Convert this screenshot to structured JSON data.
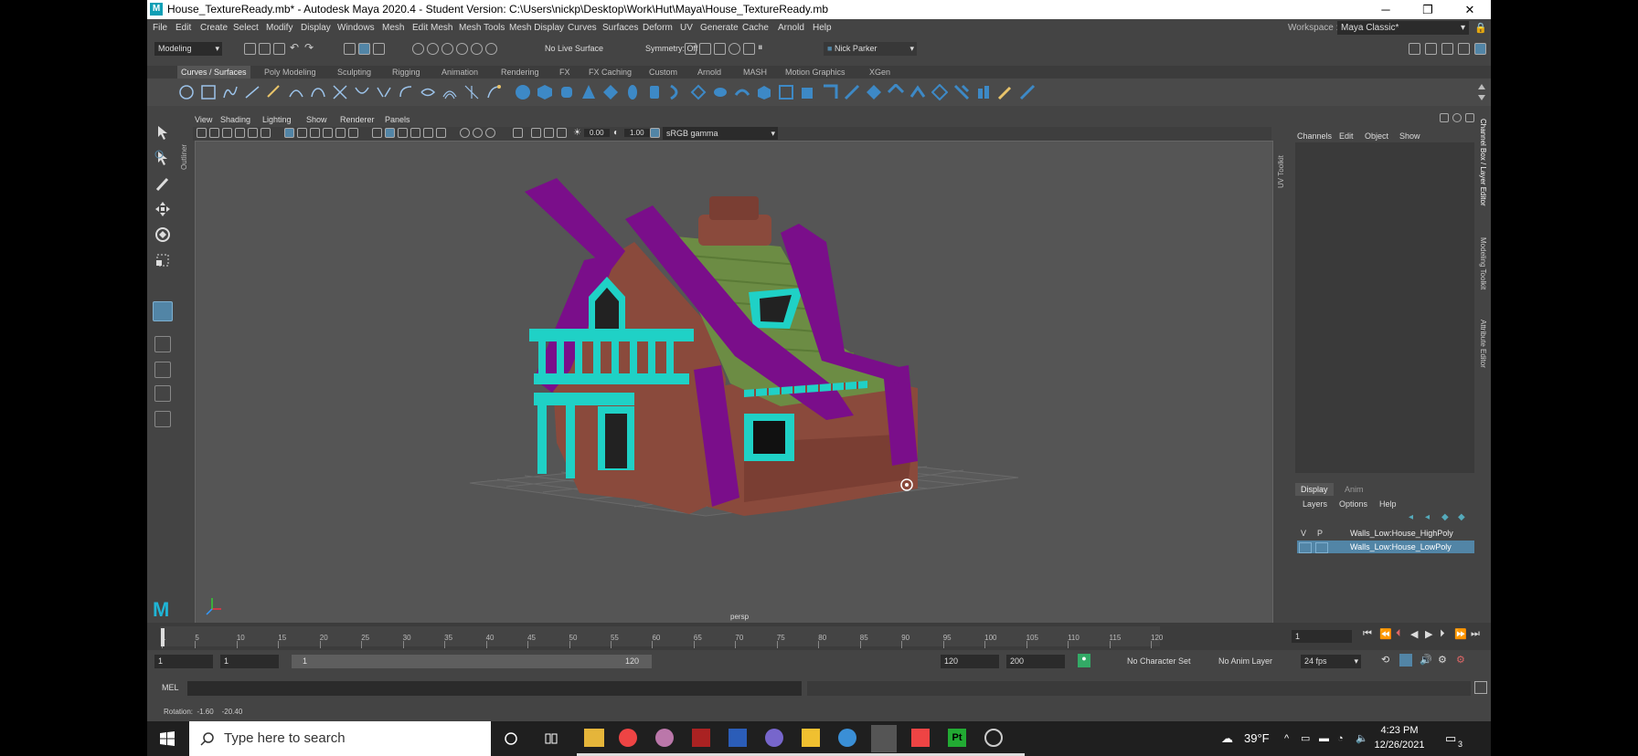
{
  "window": {
    "title": "House_TextureReady.mb* - Autodesk Maya 2020.4 - Student Version: C:\\Users\\nickp\\Desktop\\Work\\Hut\\Maya\\House_TextureReady.mb",
    "minimize": "─",
    "restore": "❐",
    "close": "✕",
    "logo": "M"
  },
  "menu": {
    "items": [
      "File",
      "Edit",
      "Create",
      "Select",
      "Modify",
      "Display",
      "Windows",
      "Mesh",
      "Edit Mesh",
      "Mesh Tools",
      "Mesh Display",
      "Curves",
      "Surfaces",
      "Deform",
      "UV",
      "Generate",
      "Cache",
      "Arnold",
      "Help"
    ],
    "workspace_label": "Workspace :",
    "workspace_value": "Maya Classic*"
  },
  "status": {
    "mode": "Modeling",
    "live_surface": "No Live Surface",
    "symmetry": "Symmetry: Off",
    "user": "Nick Parker"
  },
  "shelf": {
    "tabs": [
      "Curves / Surfaces",
      "Poly Modeling",
      "Sculpting",
      "Rigging",
      "Animation",
      "Rendering",
      "FX",
      "FX Caching",
      "Custom",
      "Arnold",
      "MASH",
      "Motion Graphics",
      "XGen"
    ],
    "active": "Curves / Surfaces"
  },
  "viewport": {
    "menus": [
      "View",
      "Shading",
      "Lighting",
      "Show",
      "Renderer",
      "Panels"
    ],
    "exposure": "0.00",
    "gamma": "1.00",
    "color_space": "sRGB gamma",
    "camera": "persp"
  },
  "side_tabs": {
    "outliner": "Outliner",
    "uv_toolkit": "UV Toolkit",
    "channel_layer": "Channel Box / Layer Editor",
    "modeling_toolkit": "Modeling Toolkit",
    "attribute_editor": "Attribute Editor"
  },
  "channel_box": {
    "menus": [
      "Channels",
      "Edit",
      "Object",
      "Show"
    ]
  },
  "layer_editor": {
    "tabs": [
      "Display",
      "Anim"
    ],
    "menus": [
      "Layers",
      "Options",
      "Help"
    ],
    "headers": [
      "V",
      "P"
    ],
    "layers": [
      {
        "name": "Walls_Low:House_HighPoly",
        "selected": false
      },
      {
        "name": "Walls_Low:House_LowPoly",
        "selected": true
      }
    ]
  },
  "timeline": {
    "ticks": [
      "1",
      "5",
      "10",
      "15",
      "20",
      "25",
      "30",
      "35",
      "40",
      "45",
      "50",
      "55",
      "60",
      "65",
      "70",
      "75",
      "80",
      "85",
      "90",
      "95",
      "100",
      "105",
      "110",
      "115",
      "120"
    ],
    "current_frame": "1"
  },
  "range": {
    "start": "1",
    "anim_start": "1",
    "range_start": "1",
    "range_end": "120",
    "end": "120",
    "anim_end": "200",
    "character_set": "No Character Set",
    "anim_layer": "No Anim Layer",
    "fps": "24 fps"
  },
  "command": {
    "label": "MEL"
  },
  "help_line": {
    "text": "Rotation:  -1.60    -20.40"
  },
  "taskbar": {
    "search_placeholder": "Type here to search",
    "weather": "39°F",
    "time": "4:23 PM",
    "date": "12/26/2021",
    "notifications": "3"
  },
  "colors": {
    "purple": "#7a0e8a",
    "teal": "#1fd1c6",
    "green": "#6c8c44",
    "brick": "#8a4a3c",
    "accent": "#5285a6"
  }
}
